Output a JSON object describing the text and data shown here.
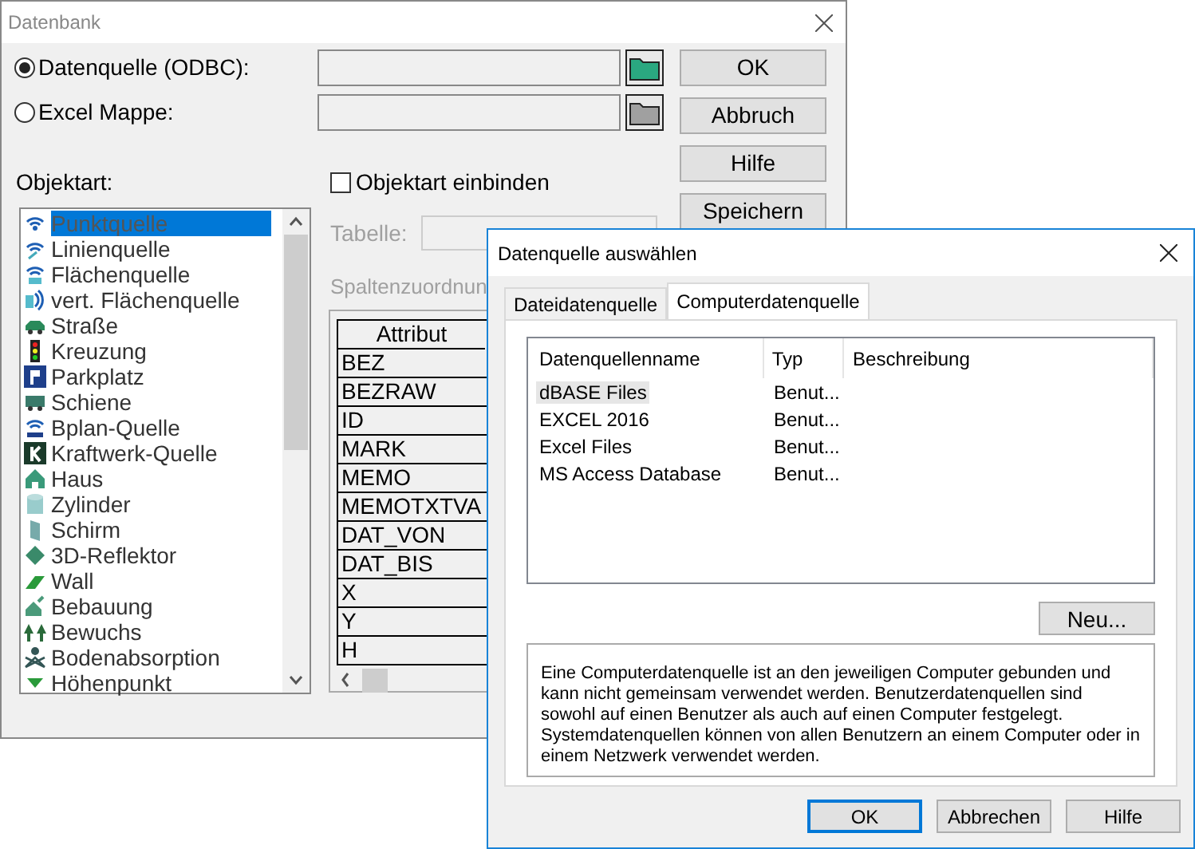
{
  "main_window": {
    "title": "Datenbank",
    "sources": [
      {
        "label": "Datenquelle (ODBC):",
        "selected": true,
        "folder_enabled": true
      },
      {
        "label": "Excel Mappe:",
        "selected": false,
        "folder_enabled": false
      }
    ],
    "buttons": [
      "OK",
      "Abbruch",
      "Hilfe",
      "Speichern"
    ],
    "object_type_label": "Objektart:",
    "object_types": [
      {
        "label": "Punktquelle",
        "selected": true
      },
      {
        "label": "Linienquelle",
        "selected": false
      },
      {
        "label": "Flächenquelle",
        "selected": false
      },
      {
        "label": "vert. Flächenquelle",
        "selected": false
      },
      {
        "label": "Straße",
        "selected": false
      },
      {
        "label": "Kreuzung",
        "selected": false
      },
      {
        "label": "Parkplatz",
        "selected": false
      },
      {
        "label": "Schiene",
        "selected": false
      },
      {
        "label": "Bplan-Quelle",
        "selected": false
      },
      {
        "label": "Kraftwerk-Quelle",
        "selected": false
      },
      {
        "label": "Haus",
        "selected": false
      },
      {
        "label": "Zylinder",
        "selected": false
      },
      {
        "label": "Schirm",
        "selected": false
      },
      {
        "label": "3D-Reflektor",
        "selected": false
      },
      {
        "label": "Wall",
        "selected": false
      },
      {
        "label": "Bebauung",
        "selected": false
      },
      {
        "label": "Bewuchs",
        "selected": false
      },
      {
        "label": "Bodenabsorption",
        "selected": false
      },
      {
        "label": "Höhenpunkt",
        "selected": false
      }
    ],
    "include_checkbox": {
      "label": "Objektart einbinden",
      "checked": false
    },
    "table_field": {
      "label": "Tabelle:",
      "disabled": true
    },
    "column_mapping": {
      "label": "Spaltenzuordnun",
      "disabled": true,
      "header": "Attribut",
      "rows": [
        "BEZ",
        "BEZRAW",
        "ID",
        "MARK",
        "MEMO",
        "MEMOTXTVA",
        "DAT_VON",
        "DAT_BIS",
        "X",
        "Y",
        "H"
      ]
    }
  },
  "dialog": {
    "title": "Datenquelle auswählen",
    "tabs": [
      {
        "label": "Dateidatenquelle",
        "selected": false
      },
      {
        "label": "Computerdatenquelle",
        "selected": true
      }
    ],
    "columns": [
      "Datenquellenname",
      "Typ",
      "Beschreibung"
    ],
    "rows": [
      {
        "name": "dBASE Files",
        "type": "Benut...",
        "selected": true
      },
      {
        "name": "EXCEL 2016",
        "type": "Benut...",
        "selected": false
      },
      {
        "name": "Excel Files",
        "type": "Benut...",
        "selected": false
      },
      {
        "name": "MS Access Database",
        "type": "Benut...",
        "selected": false
      }
    ],
    "new_button": "Neu...",
    "description": "Eine Computerdatenquelle ist an den jeweiligen Computer gebunden und kann nicht gemeinsam verwendet werden. Benutzerdatenquellen sind sowohl auf einen Benutzer als auch auf einen Computer festgelegt. Systemdatenquellen können von allen Benutzern an einem Computer oder in einem Netzwerk verwendet werden.",
    "buttons": [
      {
        "label": "OK",
        "default": true
      },
      {
        "label": "Abbrechen",
        "default": false
      },
      {
        "label": "Hilfe",
        "default": false
      }
    ]
  }
}
